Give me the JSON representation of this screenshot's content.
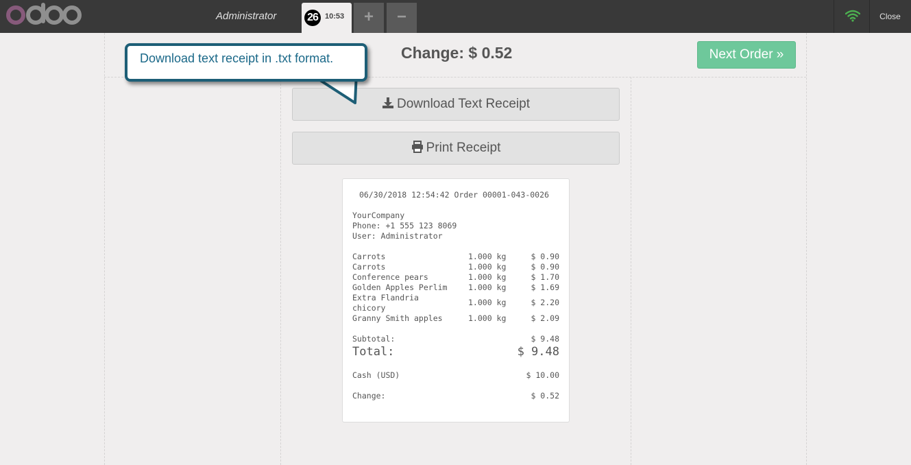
{
  "header": {
    "brand": "odoo",
    "user": "Administrator",
    "order_tab": {
      "number": "26",
      "time": "10:53"
    },
    "add_order": "+",
    "remove_order": "−",
    "close": "Close"
  },
  "screen": {
    "change_title": "Change: $ 0.52",
    "next_order": "Next Order »",
    "download_receipt": "Download Text Receipt",
    "print_receipt": "Print Receipt"
  },
  "callout": {
    "text": "Download text receipt in .txt format."
  },
  "receipt": {
    "header": "06/30/2018 12:54:42 Order 00001-043-0026",
    "company": "YourCompany",
    "phone": "Phone: +1 555 123 8069",
    "user": "User: Administrator",
    "lines": [
      {
        "product": "Carrots",
        "qty": "1.000 kg",
        "price": "$ 0.90"
      },
      {
        "product": "Carrots",
        "qty": "1.000 kg",
        "price": "$ 0.90"
      },
      {
        "product": "Conference pears",
        "qty": "1.000 kg",
        "price": "$ 1.70"
      },
      {
        "product": "Golden Apples Perlim",
        "qty": "1.000 kg",
        "price": "$ 1.69"
      },
      {
        "product": "Extra Flandria",
        "product_2": "chicory",
        "qty": "1.000 kg",
        "price": "$ 2.20"
      },
      {
        "product": "Granny Smith apples",
        "qty": "1.000 kg",
        "price": "$ 2.09"
      }
    ],
    "subtotal_label": "Subtotal:",
    "subtotal": "$ 9.48",
    "total_label": "Total:",
    "total": "$ 9.48",
    "payment_label": "Cash (USD)",
    "payment": "$ 10.00",
    "change_label": "Change:",
    "change": "$ 0.52"
  },
  "colors": {
    "topbar": "#393939",
    "accent_green": "#6ec89b",
    "wifi": "#4caf50",
    "callout_border": "#1d5e76"
  }
}
